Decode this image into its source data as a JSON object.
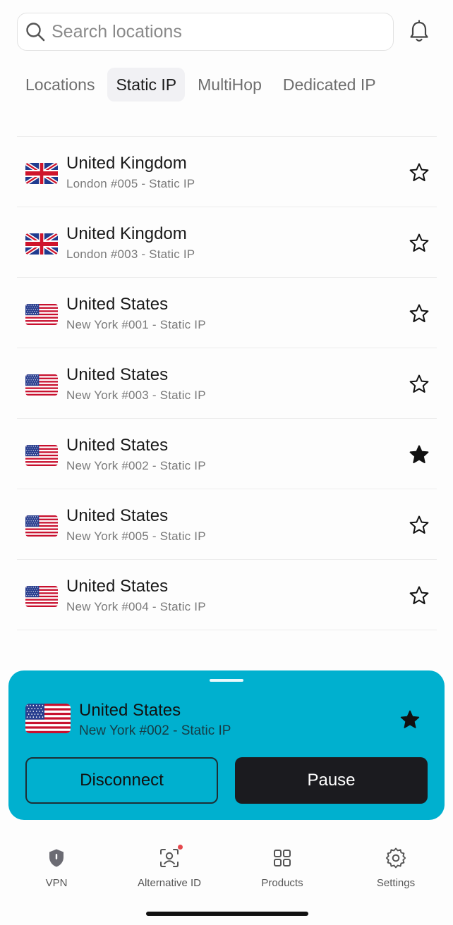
{
  "search": {
    "placeholder": "Search locations",
    "icon": "search-icon"
  },
  "header": {
    "notifications_icon": "bell-icon"
  },
  "tabs": [
    {
      "label": "Locations",
      "active": false
    },
    {
      "label": "Static IP",
      "active": true
    },
    {
      "label": "MultiHop",
      "active": false
    },
    {
      "label": "Dedicated IP",
      "active": false
    }
  ],
  "servers": [
    {
      "country": "United Kingdom",
      "server": "London #005 - Static IP",
      "flag": "uk-flag",
      "favorite": false
    },
    {
      "country": "United Kingdom",
      "server": "London #003 - Static IP",
      "flag": "uk-flag",
      "favorite": false
    },
    {
      "country": "United States",
      "server": "New York #001 - Static IP",
      "flag": "us-flag",
      "favorite": false
    },
    {
      "country": "United States",
      "server": "New York #003 - Static IP",
      "flag": "us-flag",
      "favorite": false
    },
    {
      "country": "United States",
      "server": "New York #002 - Static IP",
      "flag": "us-flag",
      "favorite": true
    },
    {
      "country": "United States",
      "server": "New York #005 - Static IP",
      "flag": "us-flag",
      "favorite": false
    },
    {
      "country": "United States",
      "server": "New York #004 - Static IP",
      "flag": "us-flag",
      "favorite": false
    }
  ],
  "connection": {
    "country": "United States",
    "server": "New York #002 - Static IP",
    "flag": "us-flag",
    "favorite": true,
    "disconnect_label": "Disconnect",
    "pause_label": "Pause"
  },
  "nav": [
    {
      "label": "VPN",
      "icon": "shield-icon"
    },
    {
      "label": "Alternative ID",
      "icon": "alternative-id-icon",
      "has_notification": true
    },
    {
      "label": "Products",
      "icon": "grid-icon"
    },
    {
      "label": "Settings",
      "icon": "gear-icon"
    }
  ],
  "colors": {
    "accent": "#00b0cf",
    "pause_button": "#1b1b1f",
    "notification_dot": "#e5484d"
  }
}
